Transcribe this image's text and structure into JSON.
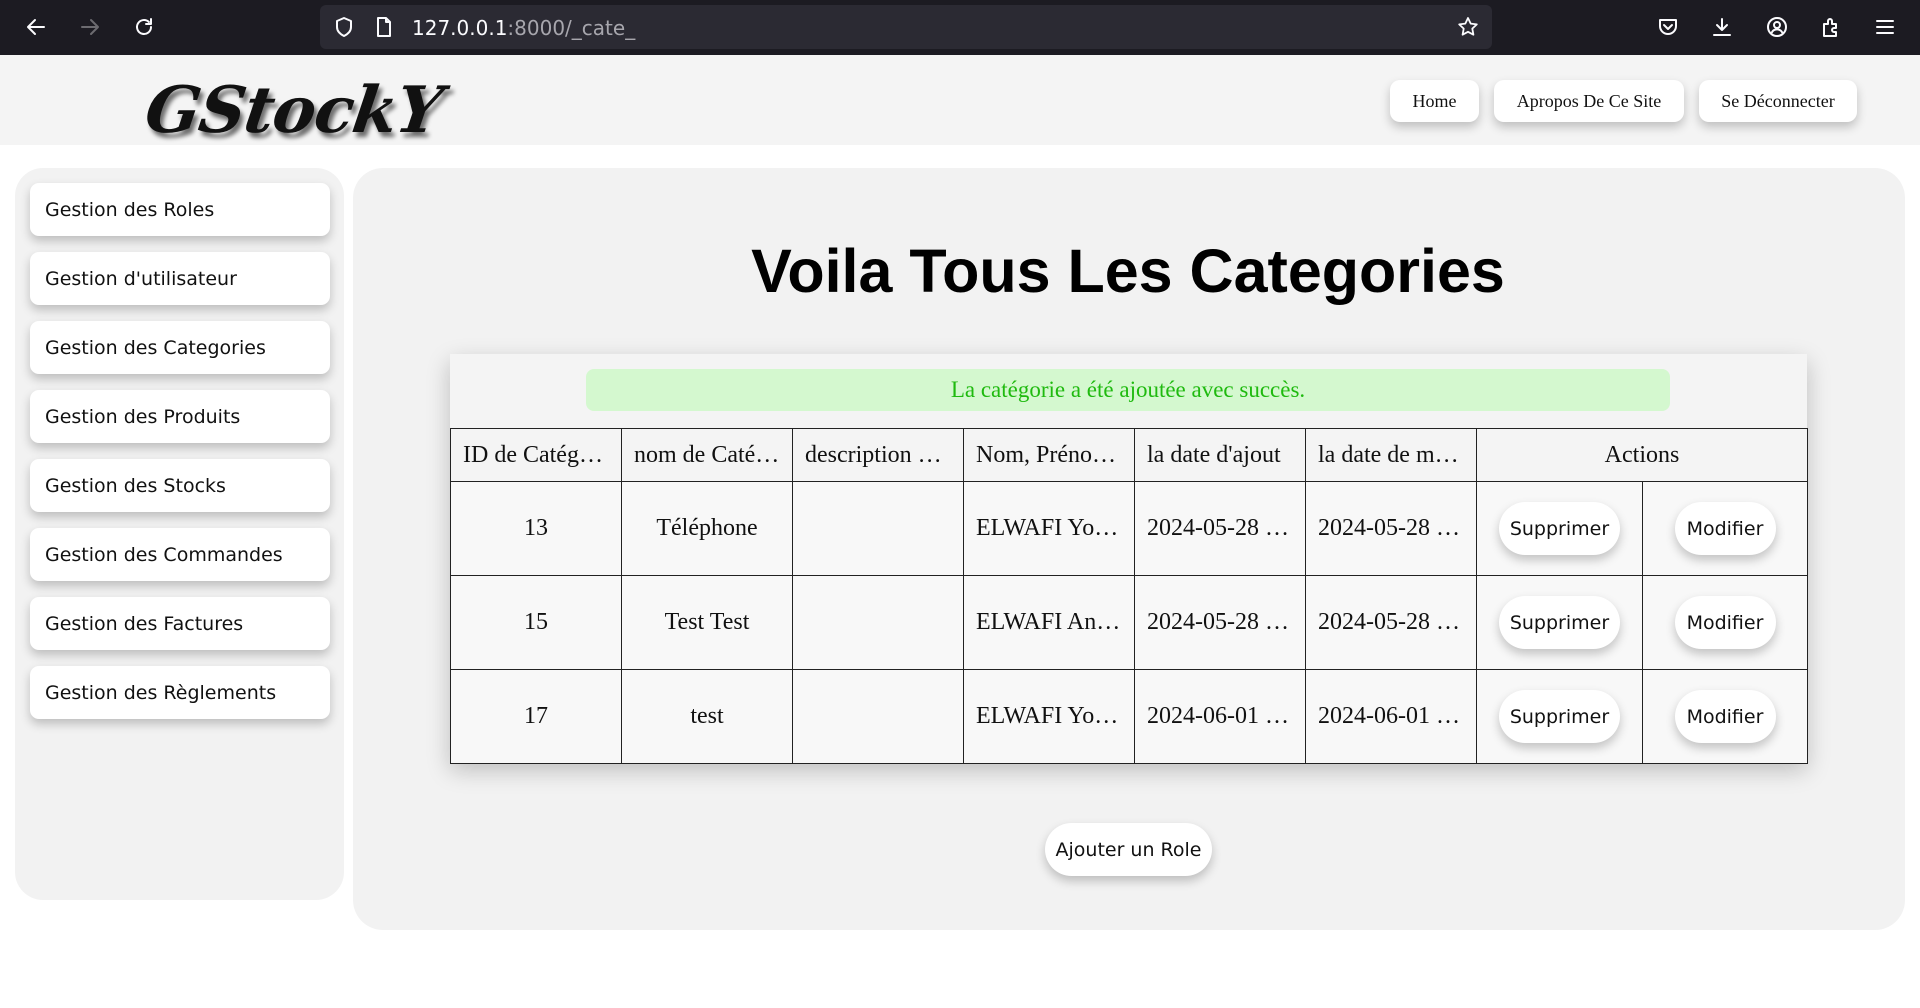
{
  "browser": {
    "url_host": "127.0.0.1",
    "url_rest": ":8000/_cate_"
  },
  "header": {
    "logo": "GStockY",
    "nav": [
      {
        "label": "Home"
      },
      {
        "label": "Apropos De Ce Site"
      },
      {
        "label": "Se Déconnecter"
      }
    ]
  },
  "sidebar": {
    "items": [
      {
        "label": "Gestion des Roles"
      },
      {
        "label": "Gestion d'utilisateur"
      },
      {
        "label": "Gestion des Categories"
      },
      {
        "label": "Gestion des Produits"
      },
      {
        "label": "Gestion des Stocks"
      },
      {
        "label": "Gestion des Commandes"
      },
      {
        "label": "Gestion des Factures"
      },
      {
        "label": "Gestion des Règlements"
      }
    ]
  },
  "main": {
    "title": "Voila Tous Les Categories",
    "success_message": "La catégorie a été ajoutée avec succès.",
    "table": {
      "headers": [
        "ID de Catég…",
        "nom de Caté…",
        "description …",
        "Nom, Préno…",
        "la date d'ajout",
        "la date de m…",
        "Actions"
      ],
      "rows": [
        {
          "id": "13",
          "name": "Téléphone",
          "description": "",
          "author": "ELWAFI Yo…",
          "date_added": "2024-05-28 …",
          "date_modified": "2024-05-28 …"
        },
        {
          "id": "15",
          "name": "Test Test",
          "description": "",
          "author": "ELWAFI An…",
          "date_added": "2024-05-28 …",
          "date_modified": "2024-05-28 …"
        },
        {
          "id": "17",
          "name": "test",
          "description": "",
          "author": "ELWAFI Yo…",
          "date_added": "2024-06-01 …",
          "date_modified": "2024-06-01 …"
        }
      ],
      "delete_label": "Supprimer",
      "edit_label": "Modifier"
    },
    "add_button": "Ajouter un Role"
  },
  "colors": {
    "browser_bar": "#1c1b22",
    "url_box": "#2b2a33",
    "panel_bg": "#f2f2f2",
    "success_bg": "#d4f8cf",
    "success_text": "#1fba0f"
  }
}
